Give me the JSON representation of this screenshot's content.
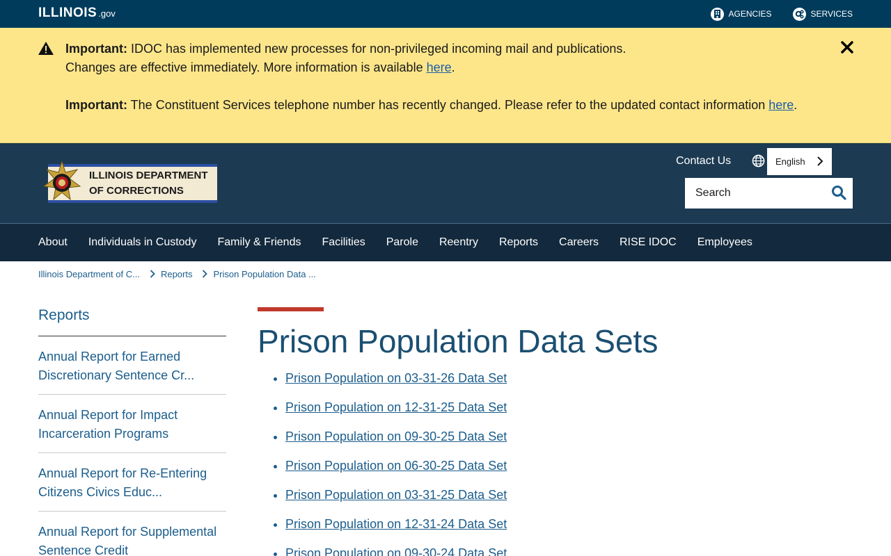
{
  "state_bar": {
    "logo_text": "ILLINOIS",
    "logo_suffix": ".gov",
    "agencies": "AGENCIES",
    "services": "SERVICES"
  },
  "alerts": [
    {
      "label": "Important:",
      "text_1": " IDOC has implemented new processes for non-privileged incoming mail and publications.",
      "text_2": "Changes are effective immediately. More information is available ",
      "link": "here",
      "end": "."
    },
    {
      "label": "Important:",
      "text": " The Constituent Services telephone number has recently changed. Please refer to the updated contact information ",
      "link": "here",
      "end": "."
    }
  ],
  "header": {
    "agency_line1": "ILLINOIS DEPARTMENT",
    "agency_line2": "OF CORRECTIONS",
    "contact": "Contact Us",
    "language": "English",
    "search_placeholder": "Search"
  },
  "nav": [
    "About",
    "Individuals in Custody",
    "Family & Friends",
    "Facilities",
    "Parole",
    "Reentry",
    "Reports",
    "Careers",
    "RISE IDOC",
    "Employees"
  ],
  "breadcrumb": [
    "Illinois Department of C...",
    "Reports",
    "Prison Population Data ..."
  ],
  "sidebar": {
    "title": "Reports",
    "items": [
      "Annual Report for Earned Discretionary Sentence Cr...",
      "Annual Report for Impact Incarceration Programs",
      "Annual Report for Re-Entering Citizens Civics Educ...",
      "Annual Report for Supplemental Sentence Credit"
    ]
  },
  "main": {
    "title": "Prison Population Data Sets",
    "items": [
      "Prison Population on 03-31-26 Data Set",
      "Prison Population on 12-31-25 Data Set",
      "Prison Population on 09-30-25 Data Set",
      "Prison Population on 06-30-25 Data Set",
      "Prison Population on 03-31-25 Data Set",
      "Prison Population on 12-31-24 Data Set",
      "Prison Population on 09-30-24 Data Set"
    ]
  },
  "colors": {
    "state_bar": "#003b5c",
    "alert_bg": "#fde68a",
    "header_bg": "#1c3a52",
    "nav_bg": "#13293d",
    "link": "#1b5d8c",
    "title": "#1b4f72",
    "accent_red": "#c0392b"
  }
}
